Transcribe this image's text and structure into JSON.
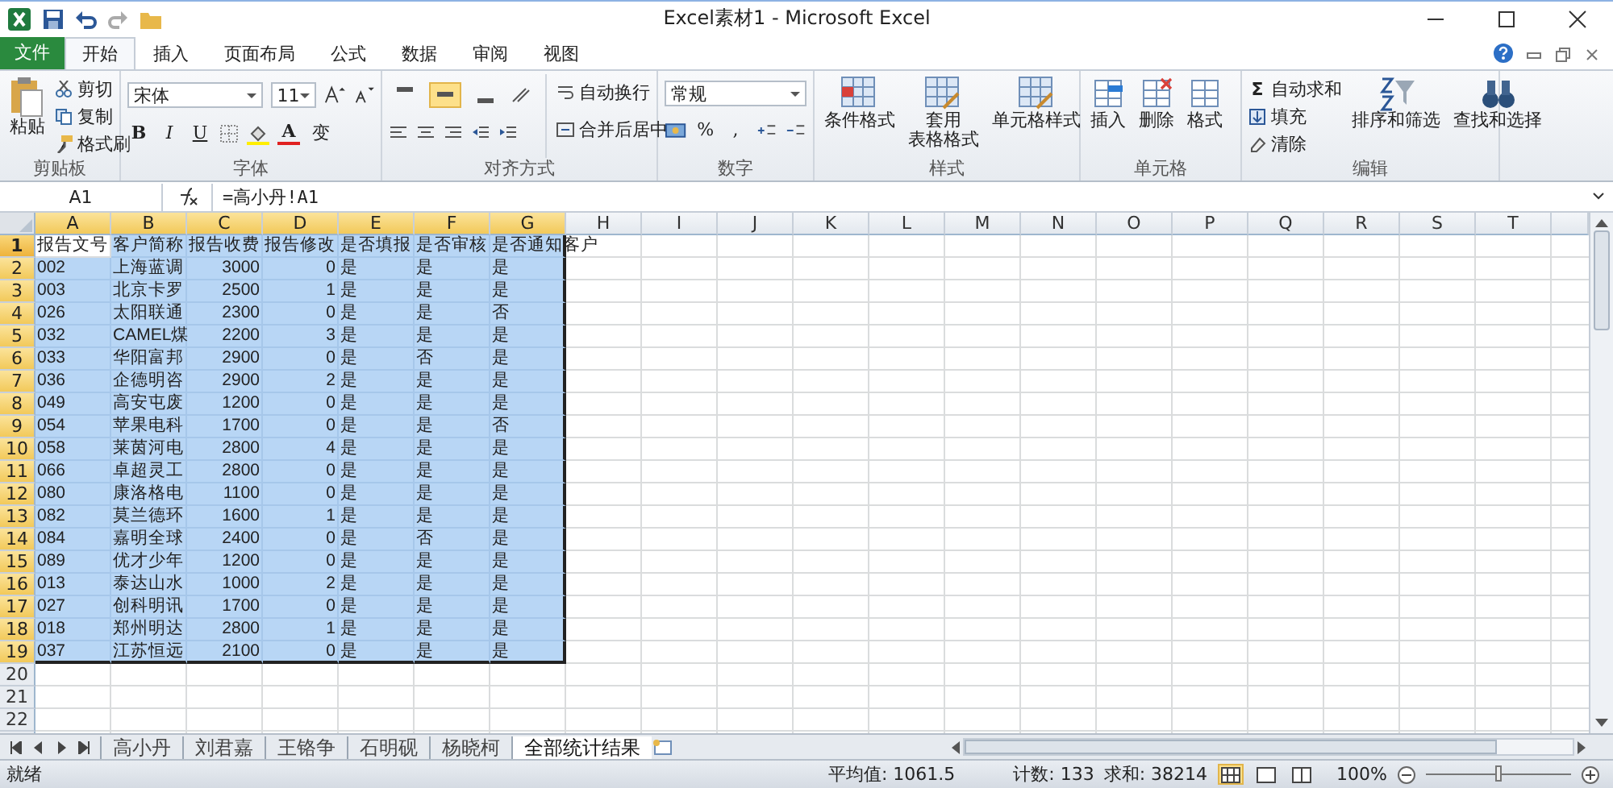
{
  "window": {
    "title": "Excel素材1 - Microsoft Excel"
  },
  "ribbon_tabs": [
    {
      "label": "文件",
      "kind": "file",
      "selected": false
    },
    {
      "label": "开始",
      "kind": "tab",
      "selected": true
    },
    {
      "label": "插入",
      "kind": "tab",
      "selected": false
    },
    {
      "label": "页面布局",
      "kind": "tab",
      "selected": false
    },
    {
      "label": "公式",
      "kind": "tab",
      "selected": false
    },
    {
      "label": "数据",
      "kind": "tab",
      "selected": false
    },
    {
      "label": "审阅",
      "kind": "tab",
      "selected": false
    },
    {
      "label": "视图",
      "kind": "tab",
      "selected": false
    }
  ],
  "ribbon": {
    "clipboard": {
      "label": "剪贴板",
      "paste": "粘贴",
      "cut": "剪切",
      "copy": "复制",
      "painter": "格式刷"
    },
    "font": {
      "label": "字体",
      "font_name": "宋体",
      "font_size": "11",
      "bold": "B",
      "italic": "I",
      "underline": "U",
      "font_color_letter": "A",
      "phonetic": "变"
    },
    "alignment": {
      "label": "对齐方式",
      "aligns": [
        {
          "selected": false
        },
        {
          "selected": true
        },
        {
          "selected": false
        }
      ],
      "wrap": "自动换行",
      "merge": "合并后居中"
    },
    "number": {
      "label": "数字",
      "format": "常规",
      "percent": "%",
      "comma": ","
    },
    "styles": {
      "label": "样式",
      "items": [
        {
          "lines": [
            "条件格式"
          ]
        },
        {
          "lines": [
            "套用",
            "表格格式"
          ]
        },
        {
          "lines": [
            "单元格样式"
          ]
        }
      ]
    },
    "cells": {
      "label": "单元格",
      "items": [
        "插入",
        "删除",
        "格式"
      ]
    },
    "editing": {
      "label": "编辑",
      "sum_symbol": "Σ",
      "autosum": "自动求和",
      "fill": "填充",
      "clear": "清除",
      "big": [
        "排序和筛选",
        "查找和选择"
      ]
    }
  },
  "formula_bar": {
    "name_box": "A1",
    "formula": "=高小丹!A1"
  },
  "sheet": {
    "columns": [
      {
        "label": "A",
        "selected": true
      },
      {
        "label": "B",
        "selected": true
      },
      {
        "label": "C",
        "selected": true
      },
      {
        "label": "D",
        "selected": true
      },
      {
        "label": "E",
        "selected": true
      },
      {
        "label": "F",
        "selected": true
      },
      {
        "label": "G",
        "selected": true
      },
      {
        "label": "H",
        "selected": false
      },
      {
        "label": "I",
        "selected": false
      },
      {
        "label": "J",
        "selected": false
      },
      {
        "label": "K",
        "selected": false
      },
      {
        "label": "L",
        "selected": false
      },
      {
        "label": "M",
        "selected": false
      },
      {
        "label": "N",
        "selected": false
      },
      {
        "label": "O",
        "selected": false
      },
      {
        "label": "P",
        "selected": false
      },
      {
        "label": "Q",
        "selected": false
      },
      {
        "label": "R",
        "selected": false
      },
      {
        "label": "S",
        "selected": false
      },
      {
        "label": "T",
        "selected": false
      }
    ],
    "rows": [
      {
        "header": "1",
        "selected": true,
        "active": true,
        "cells": [
          "报告文号",
          "客户简称",
          "报告收费",
          "报告修改",
          "是否填报",
          "是否审核",
          "是否通知客户"
        ]
      },
      {
        "header": "2",
        "selected": true,
        "active": false,
        "cells": [
          "002",
          "上海蓝调",
          "3000",
          "0",
          "是",
          "是",
          "是"
        ]
      },
      {
        "header": "3",
        "selected": true,
        "active": false,
        "cells": [
          "003",
          "北京卡罗",
          "2500",
          "1",
          "是",
          "是",
          "是"
        ]
      },
      {
        "header": "4",
        "selected": true,
        "active": false,
        "cells": [
          "026",
          "太阳联通",
          "2300",
          "0",
          "是",
          "是",
          "否"
        ]
      },
      {
        "header": "5",
        "selected": true,
        "active": false,
        "cells": [
          "032",
          "CAMEL煤",
          "2200",
          "3",
          "是",
          "是",
          "是"
        ]
      },
      {
        "header": "6",
        "selected": true,
        "active": false,
        "cells": [
          "033",
          "华阳富邦",
          "2900",
          "0",
          "是",
          "否",
          "是"
        ]
      },
      {
        "header": "7",
        "selected": true,
        "active": false,
        "cells": [
          "036",
          "企德明咨",
          "2900",
          "2",
          "是",
          "是",
          "是"
        ]
      },
      {
        "header": "8",
        "selected": true,
        "active": false,
        "cells": [
          "049",
          "高安屯废",
          "1200",
          "0",
          "是",
          "是",
          "是"
        ]
      },
      {
        "header": "9",
        "selected": true,
        "active": false,
        "cells": [
          "054",
          "苹果电科",
          "1700",
          "0",
          "是",
          "是",
          "否"
        ]
      },
      {
        "header": "10",
        "selected": true,
        "active": false,
        "cells": [
          "058",
          "莱茵河电",
          "2800",
          "4",
          "是",
          "是",
          "是"
        ]
      },
      {
        "header": "11",
        "selected": true,
        "active": false,
        "cells": [
          "066",
          "卓超灵工",
          "2800",
          "0",
          "是",
          "是",
          "是"
        ]
      },
      {
        "header": "12",
        "selected": true,
        "active": false,
        "cells": [
          "080",
          "康洛格电",
          "1100",
          "0",
          "是",
          "是",
          "是"
        ]
      },
      {
        "header": "13",
        "selected": true,
        "active": false,
        "cells": [
          "082",
          "莫兰德环",
          "1600",
          "1",
          "是",
          "是",
          "是"
        ]
      },
      {
        "header": "14",
        "selected": true,
        "active": false,
        "cells": [
          "084",
          "嘉明全球",
          "2400",
          "0",
          "是",
          "否",
          "是"
        ]
      },
      {
        "header": "15",
        "selected": true,
        "active": false,
        "cells": [
          "089",
          "优才少年",
          "1200",
          "0",
          "是",
          "是",
          "是"
        ]
      },
      {
        "header": "16",
        "selected": true,
        "active": false,
        "cells": [
          "013",
          "泰达山水",
          "1000",
          "2",
          "是",
          "是",
          "是"
        ]
      },
      {
        "header": "17",
        "selected": true,
        "active": false,
        "cells": [
          "027",
          "创科明讯",
          "1700",
          "0",
          "是",
          "是",
          "是"
        ]
      },
      {
        "header": "18",
        "selected": true,
        "active": false,
        "cells": [
          "018",
          "郑州明达",
          "2800",
          "1",
          "是",
          "是",
          "是"
        ]
      },
      {
        "header": "19",
        "selected": true,
        "active": false,
        "cells": [
          "037",
          "江苏恒远",
          "2100",
          "0",
          "是",
          "是",
          "是"
        ]
      },
      {
        "header": "20",
        "selected": false,
        "active": false,
        "cells": []
      },
      {
        "header": "21",
        "selected": false,
        "active": false,
        "cells": []
      },
      {
        "header": "22",
        "selected": false,
        "active": false,
        "cells": []
      }
    ]
  },
  "sheet_tabs": [
    {
      "label": "高小丹",
      "selected": false
    },
    {
      "label": "刘君嘉",
      "selected": false
    },
    {
      "label": "王铬争",
      "selected": false
    },
    {
      "label": "石明砚",
      "selected": false
    },
    {
      "label": "杨晓柯",
      "selected": false
    },
    {
      "label": "全部统计结果",
      "selected": true
    }
  ],
  "status_bar": {
    "ready": "就绪",
    "average": "平均值: 1061.5",
    "count": "计数: 133",
    "sum": "求和: 38214",
    "views": [
      {
        "selected": true
      },
      {
        "selected": false
      },
      {
        "selected": false
      }
    ],
    "zoom": "100%",
    "zoom_slider": {
      "level": 0.5
    }
  }
}
